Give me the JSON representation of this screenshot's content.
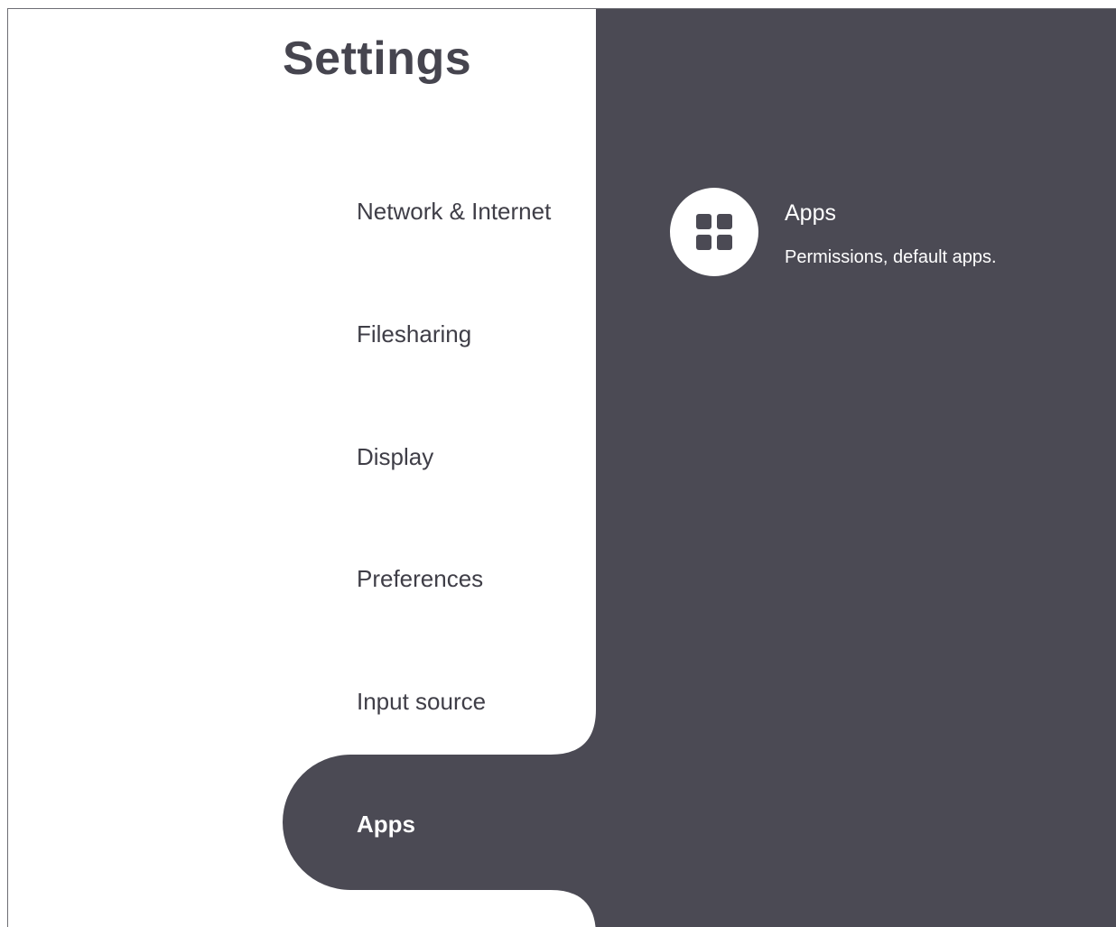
{
  "page": {
    "title": "Settings"
  },
  "sidebar": {
    "items": [
      {
        "label": "Network & Internet"
      },
      {
        "label": "Filesharing"
      },
      {
        "label": "Display"
      },
      {
        "label": "Preferences"
      },
      {
        "label": "Input source"
      },
      {
        "label": "Apps",
        "selected": true
      }
    ]
  },
  "detail": {
    "items": [
      {
        "icon": "apps-grid-icon",
        "title": "Apps",
        "subtitle": "Permissions, default apps."
      }
    ]
  },
  "colors": {
    "panel_background": "#4b4a54",
    "page_background": "#ffffff",
    "text_dark": "#3f3e47",
    "text_light": "#ffffff"
  }
}
